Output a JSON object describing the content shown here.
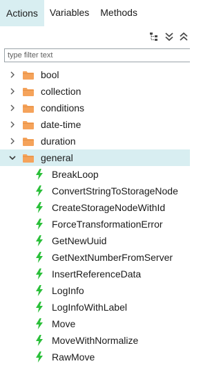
{
  "tabs": [
    {
      "label": "Actions",
      "active": true
    },
    {
      "label": "Variables",
      "active": false
    },
    {
      "label": "Methods",
      "active": false
    }
  ],
  "toolbar": {
    "icons": [
      "hierarchy-icon",
      "expand-all-icon",
      "collapse-all-icon"
    ]
  },
  "filter": {
    "placeholder": "type filter text",
    "value": ""
  },
  "tree": {
    "folders": [
      {
        "label": "bool",
        "expanded": false
      },
      {
        "label": "collection",
        "expanded": false
      },
      {
        "label": "conditions",
        "expanded": false
      },
      {
        "label": "date-time",
        "expanded": false
      },
      {
        "label": "duration",
        "expanded": false
      },
      {
        "label": "general",
        "expanded": true
      }
    ],
    "actions": [
      "BreakLoop",
      "ConvertStringToStorageNode",
      "CreateStorageNodeWithId",
      "ForceTransformationError",
      "GetNewUuid",
      "GetNextNumberFromServer",
      "InsertReferenceData",
      "LogInfo",
      "LogInfoWithLabel",
      "Move",
      "MoveWithNormalize",
      "RawMove"
    ]
  },
  "colors": {
    "selection": "#d8eef1",
    "folder": "#f5a35b",
    "bolt": "#2bbf3a",
    "chevron": "#5a5a5a"
  }
}
